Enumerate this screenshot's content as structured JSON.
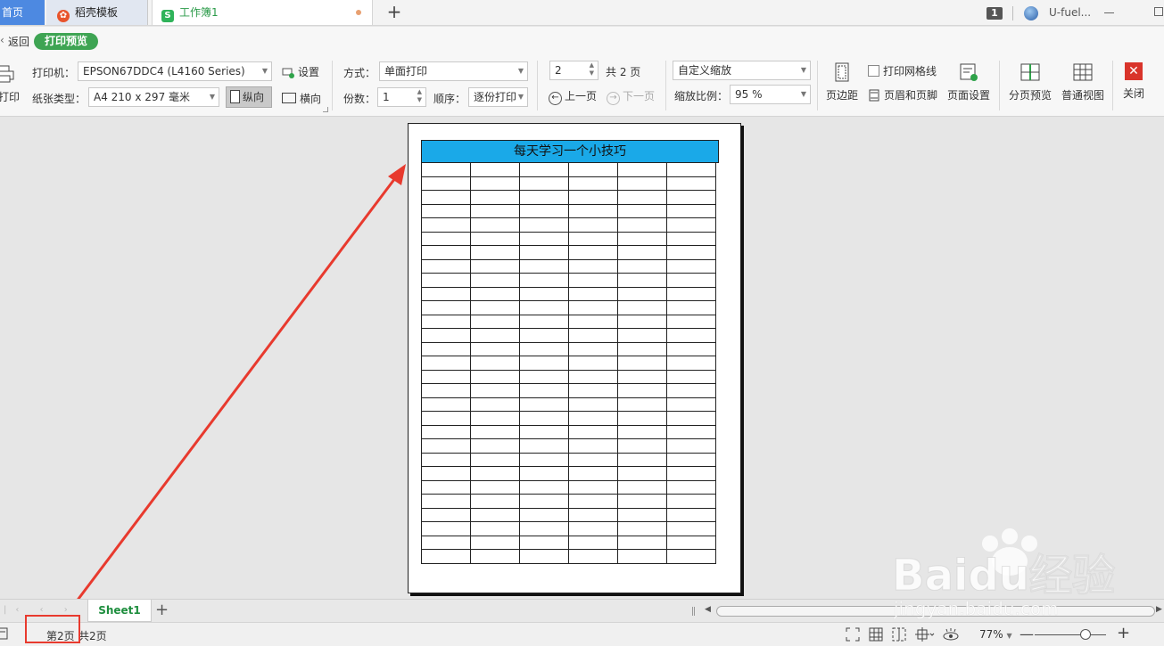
{
  "tabs": {
    "home": "首页",
    "template": "稻壳模板",
    "workbook": "工作簿1",
    "new_tab": "+"
  },
  "titlebar": {
    "badge": "1",
    "user_name": "U-fuel..."
  },
  "toolbar": {
    "back": "返回",
    "mode": "打印预览"
  },
  "ribbon": {
    "print_label": "打印",
    "printer_label": "打印机：",
    "printer_value": "EPSON67DDC4 (L4160 Series)",
    "settings": "设置",
    "paper_label": "纸张类型：",
    "paper_value": "A4 210 x 297 毫米",
    "portrait": "纵向",
    "landscape": "横向",
    "mode_label": "方式：",
    "mode_value": "单面打印",
    "copies_label": "份数：",
    "copies_value": "1",
    "order_label": "顺序：",
    "order_value": "逐份打印",
    "page_input": "2",
    "page_total": "共 2 页",
    "prev_page": "上一页",
    "next_page": "下一页",
    "scale_mode": "自定义缩放",
    "scale_label": "缩放比例：",
    "scale_value": "95 %",
    "margins": "页边距",
    "gridlines": "打印网格线",
    "header_footer": "页眉和页脚",
    "page_setup": "页面设置",
    "page_break_preview": "分页预览",
    "normal_view": "普通视图",
    "close": "关闭"
  },
  "sheet": {
    "title": "每天学习一个小技巧",
    "columns": 6,
    "rows": 29,
    "tab_name": "Sheet1"
  },
  "status": {
    "page": "第2页",
    "total": "共2页",
    "zoom": "77%"
  },
  "watermark": {
    "brand": "Baidu经验",
    "url": "jingyan.baidu.com"
  },
  "colors": {
    "accent_green": "#3ea453",
    "title_fill": "#1aa9e8",
    "annotation_red": "#e83a2e"
  }
}
